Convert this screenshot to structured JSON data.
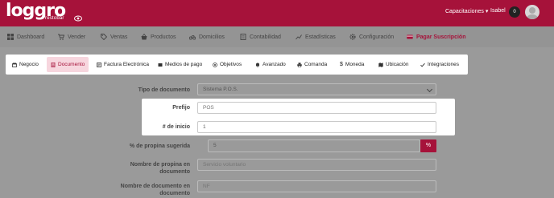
{
  "header": {
    "logo_text": "loggro",
    "logo_subtext": "restobar",
    "nav_capacitaciones": "Capacitaciones",
    "nav_user": "Isabel",
    "badge_count": "0"
  },
  "mainmenu": {
    "items": [
      {
        "label": "Dashboard",
        "icon": "dashboard-icon"
      },
      {
        "label": "Vender",
        "icon": "cart-icon"
      },
      {
        "label": "Ventas",
        "icon": "tag-icon"
      },
      {
        "label": "Productos",
        "icon": "basket-icon"
      },
      {
        "label": "Domicilios",
        "icon": "bike-icon"
      },
      {
        "label": "Contabilidad",
        "icon": "ledger-icon"
      },
      {
        "label": "Estadísticas",
        "icon": "chart-line-icon"
      },
      {
        "label": "Configuración",
        "icon": "gear-icon"
      },
      {
        "label": "Pagar Suscripción",
        "icon": "card-icon"
      }
    ],
    "active_color": "#a6123a"
  },
  "tabs": {
    "items": [
      {
        "label": "Negocio",
        "icon": "store-icon"
      },
      {
        "label": "Documento",
        "icon": "document-icon"
      },
      {
        "label": "Factura Electrónica",
        "icon": "invoice-icon"
      },
      {
        "label": "Medios de pago",
        "icon": "wallet-icon"
      },
      {
        "label": "Objetivos",
        "icon": "target-icon"
      },
      {
        "label": "Avanzado",
        "icon": "bell-icon"
      },
      {
        "label": "Comanda",
        "icon": "printer-icon"
      },
      {
        "label": "Moneda",
        "icon": "dollar-icon"
      },
      {
        "label": "Ubicación",
        "icon": "map-icon"
      },
      {
        "label": "Integraciones",
        "icon": "check-icon"
      }
    ],
    "active": "Documento"
  },
  "form": {
    "tipo_documento": {
      "label": "Tipo de documento",
      "value": "Sistema P.O.S."
    },
    "prefijo": {
      "label": "Prefijo",
      "placeholder": "POS"
    },
    "numero_inicio": {
      "label": "# de inicio",
      "value": "1"
    },
    "propina": {
      "label": "% de propina sugerida",
      "value": "5",
      "suffix": "%"
    },
    "nombre_propina": {
      "label_line1": "Nombre de propina en",
      "label_line2": "documento",
      "placeholder": "Servicio voluntario"
    },
    "nombre_documento": {
      "label_line1": "Nombre de documento en",
      "label_line2": "documento",
      "placeholder": "NF"
    }
  }
}
